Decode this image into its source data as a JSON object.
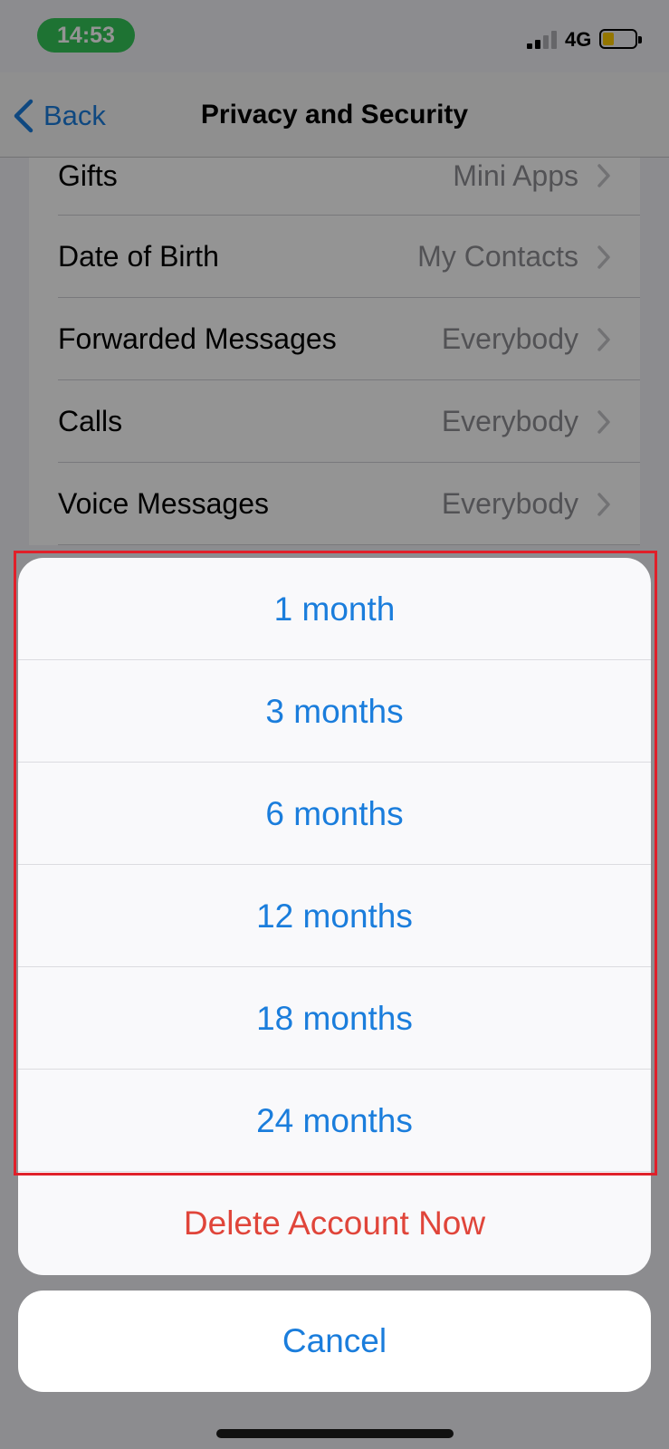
{
  "colors": {
    "accent": "#1a7ddc",
    "destructive": "#e0453a",
    "status_pill": "#34c759",
    "battery_fill": "#ffcc00",
    "highlight": "#e0202a"
  },
  "status_bar": {
    "time": "14:53",
    "network": "4G",
    "signal_bars_active": 2,
    "signal_bars_total": 4,
    "battery_level": 0.25
  },
  "nav": {
    "back_label": "Back",
    "title": "Privacy and Security"
  },
  "settings": {
    "rows": [
      {
        "label": "Gifts",
        "value": "Mini Apps"
      },
      {
        "label": "Date of Birth",
        "value": "My Contacts"
      },
      {
        "label": "Forwarded Messages",
        "value": "Everybody"
      },
      {
        "label": "Calls",
        "value": "Everybody"
      },
      {
        "label": "Voice Messages",
        "value": "Everybody"
      }
    ]
  },
  "action_sheet": {
    "options": [
      {
        "label": "1 month"
      },
      {
        "label": "3 months"
      },
      {
        "label": "6 months"
      },
      {
        "label": "12 months"
      },
      {
        "label": "18 months"
      },
      {
        "label": "24 months"
      }
    ],
    "destructive_label": "Delete Account Now",
    "cancel_label": "Cancel"
  }
}
